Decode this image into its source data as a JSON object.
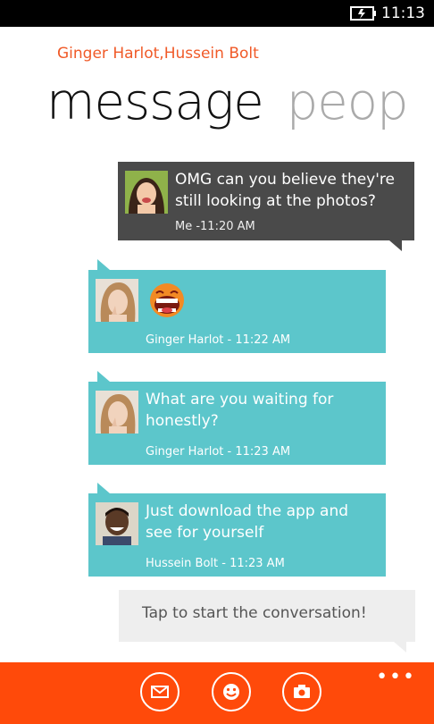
{
  "status": {
    "time": "11:13"
  },
  "header": {
    "participants": "Ginger Harlot,Hussein Bolt",
    "pivot_active": "message",
    "pivot_next": "peop"
  },
  "messages": [
    {
      "text": "OMG can you believe they're still looking at the photos?",
      "meta": "Me -11:20 AM"
    },
    {
      "text": "",
      "meta": "Ginger Harlot - 11:22 AM",
      "emoticon": "laughing-emoticon"
    },
    {
      "text": "What are you waiting for honestly?",
      "meta": "Ginger Harlot - 11:23 AM"
    },
    {
      "text": "Just download the app and see for yourself",
      "meta": "Hussein Bolt - 11:23 AM"
    }
  ],
  "compose": {
    "placeholder": "Tap to start the conversation!"
  },
  "appbar": {
    "more": "•••",
    "buttons": [
      "mail-icon",
      "smiley-icon",
      "camera-icon"
    ]
  },
  "colors": {
    "accent": "#ff4a0a",
    "incoming": "#5cc6cb",
    "outgoing": "#4a4a4a",
    "participants": "#f05a28"
  }
}
